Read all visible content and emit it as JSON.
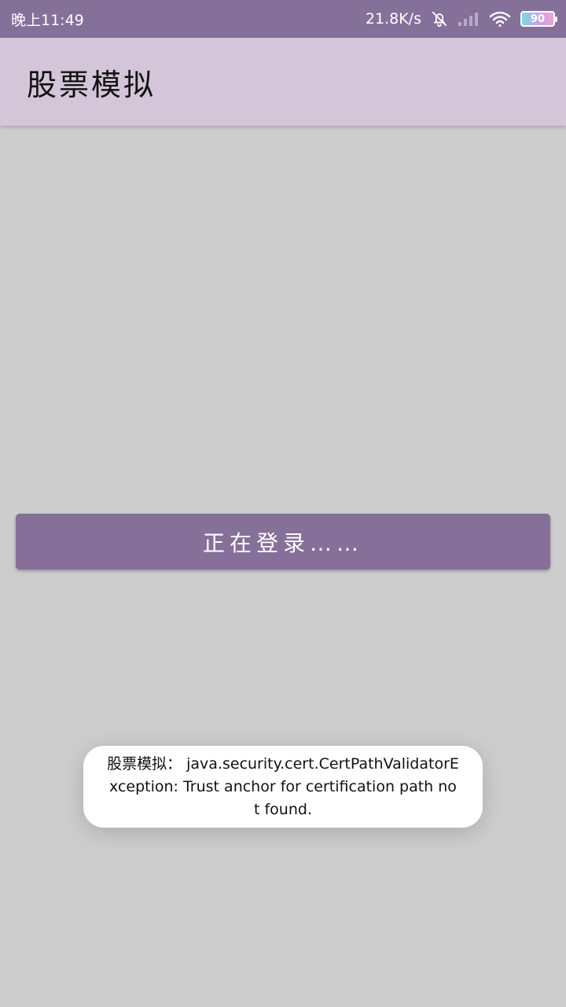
{
  "status_bar": {
    "time": "晚上11:49",
    "network_speed": "21.8K/s",
    "battery_level": "90",
    "icons": [
      "bell-off-icon",
      "signal-icon",
      "wifi-icon",
      "battery-icon"
    ],
    "background_color": "#85709a"
  },
  "app_bar": {
    "title": "股票模拟",
    "background_color": "#d4c5d8"
  },
  "main": {
    "login_button_label": "正在登录……",
    "button_color": "#86709a",
    "background_color": "#cdcdcd"
  },
  "toast": {
    "message": "股票模拟： java.security.cert.CertPathValidatorException: Trust anchor for certification path not found."
  }
}
